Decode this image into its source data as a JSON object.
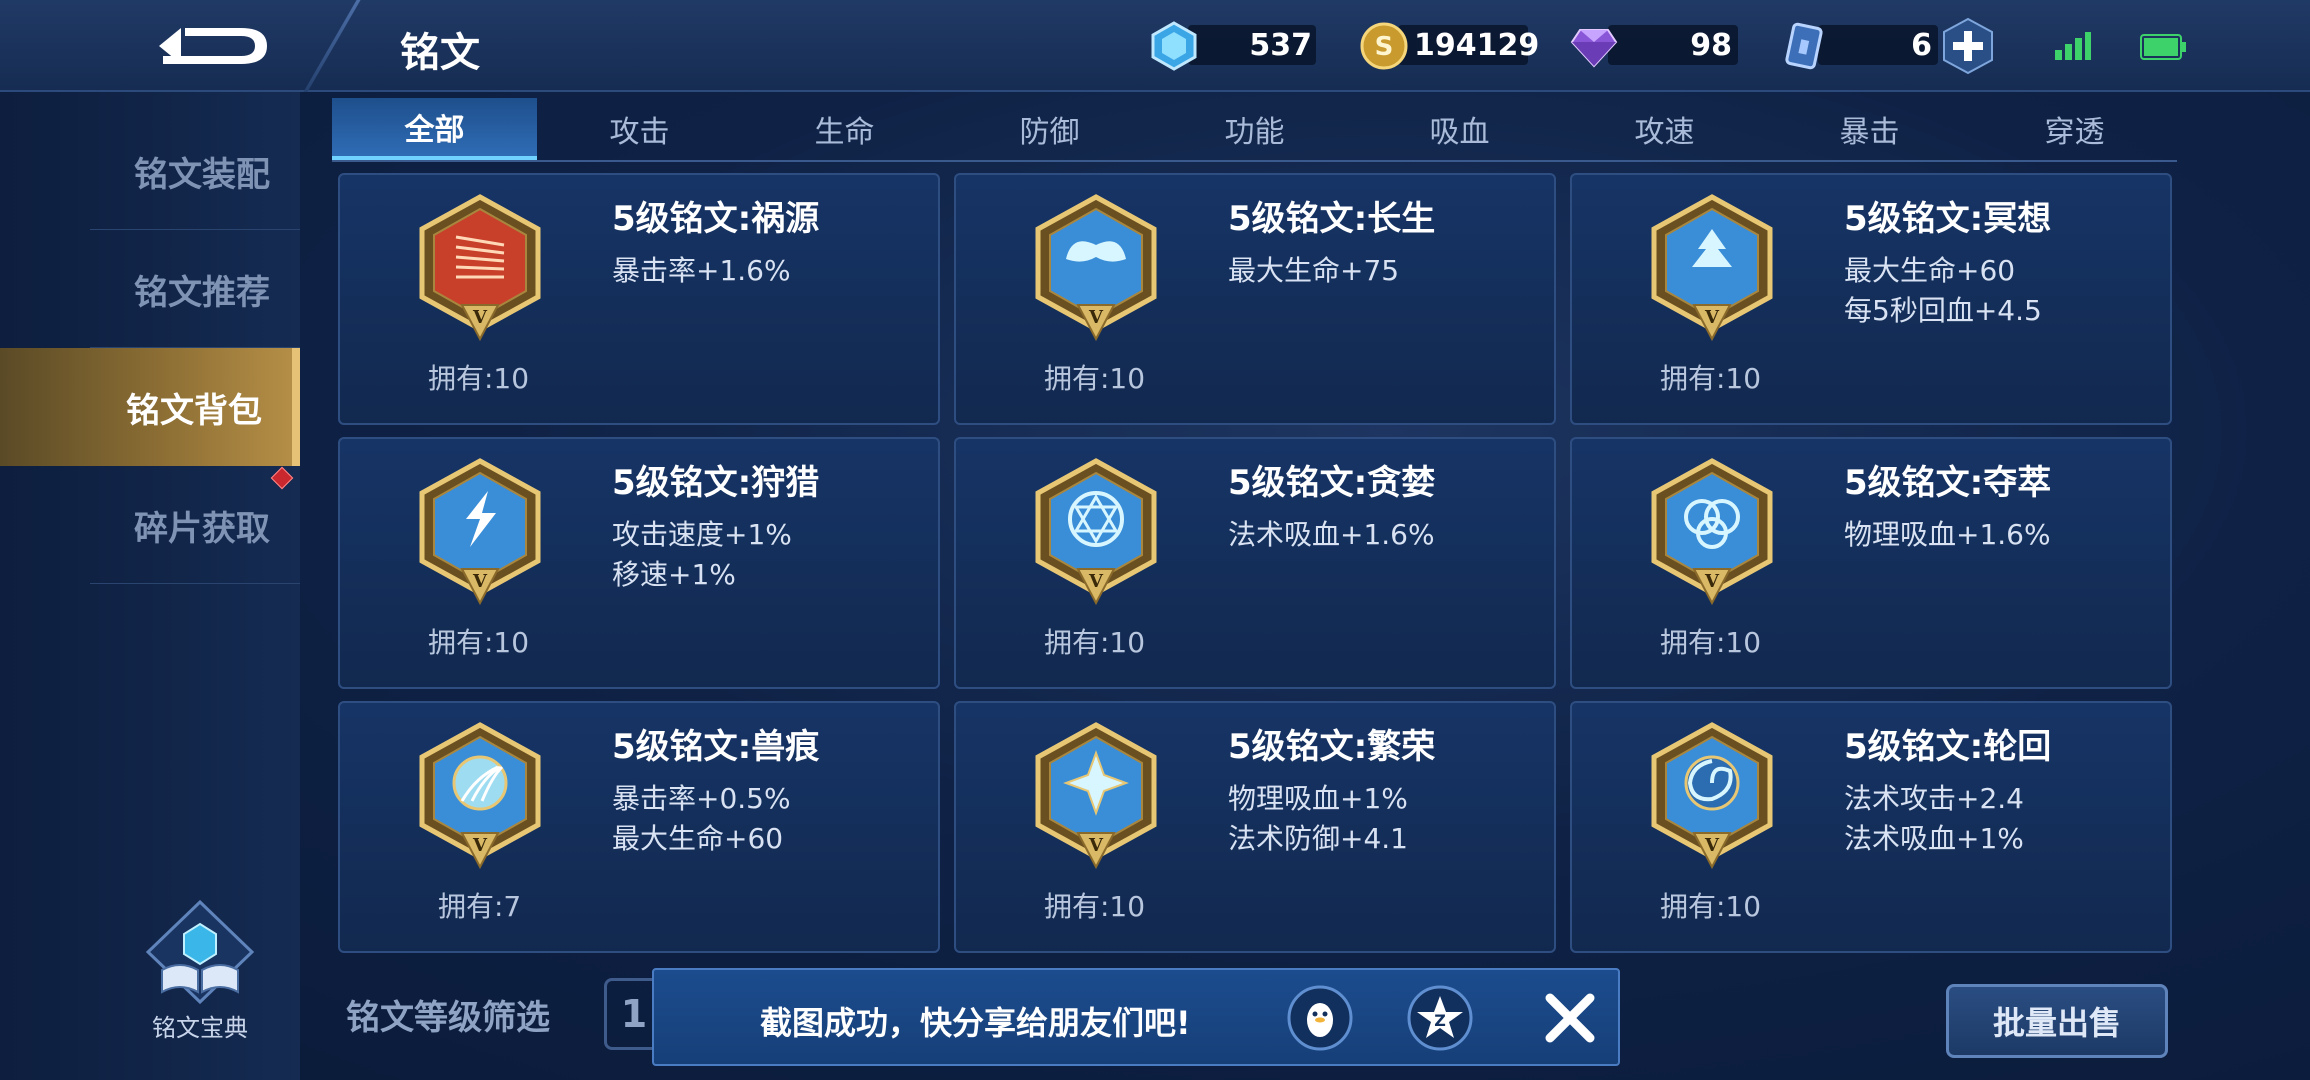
{
  "header": {
    "title": "铭文",
    "back_icon": "back-arrow-icon"
  },
  "currencies": {
    "crystal": {
      "value": "537",
      "icon": "blue-crystal-icon"
    },
    "gold": {
      "value": "194129",
      "icon": "gold-coin-icon"
    },
    "diamond": {
      "value": "98",
      "icon": "purple-diamond-icon"
    },
    "ticket": {
      "value": "6",
      "icon": "blue-card-icon"
    }
  },
  "tabs": [
    {
      "label": "全部",
      "active": true
    },
    {
      "label": "攻击"
    },
    {
      "label": "生命"
    },
    {
      "label": "防御"
    },
    {
      "label": "功能"
    },
    {
      "label": "吸血"
    },
    {
      "label": "攻速"
    },
    {
      "label": "暴击"
    },
    {
      "label": "穿透"
    }
  ],
  "sidebar": {
    "items": [
      {
        "label": "铭文装配"
      },
      {
        "label": "铭文推荐"
      },
      {
        "label": "铭文背包",
        "active": true
      },
      {
        "label": "碎片获取"
      }
    ],
    "codex_label": "铭文宝典"
  },
  "inscriptions": [
    {
      "name": "5级铭文:祸源",
      "stats": [
        "暴击率+1.6%"
      ],
      "owned": "拥有:10",
      "color": "#c8402a"
    },
    {
      "name": "5级铭文:长生",
      "stats": [
        "最大生命+75"
      ],
      "owned": "拥有:10",
      "color": "#3a8ed8"
    },
    {
      "name": "5级铭文:冥想",
      "stats": [
        "最大生命+60",
        "每5秒回血+4.5"
      ],
      "owned": "拥有:10",
      "color": "#3a8ed8"
    },
    {
      "name": "5级铭文:狩猎",
      "stats": [
        "攻击速度+1%",
        "移速+1%"
      ],
      "owned": "拥有:10",
      "color": "#3a8ed8"
    },
    {
      "name": "5级铭文:贪婪",
      "stats": [
        "法术吸血+1.6%"
      ],
      "owned": "拥有:10",
      "color": "#3a8ed8"
    },
    {
      "name": "5级铭文:夺萃",
      "stats": [
        "物理吸血+1.6%"
      ],
      "owned": "拥有:10",
      "color": "#3a8ed8"
    },
    {
      "name": "5级铭文:兽痕",
      "stats": [
        "暴击率+0.5%",
        "最大生命+60"
      ],
      "owned": "拥有:7",
      "color": "#3a8ed8"
    },
    {
      "name": "5级铭文:繁荣",
      "stats": [
        "物理吸血+1%",
        "法术防御+4.1"
      ],
      "owned": "拥有:10",
      "color": "#3a8ed8"
    },
    {
      "name": "5级铭文:轮回",
      "stats": [
        "法术攻击+2.4",
        "法术吸血+1%"
      ],
      "owned": "拥有:10",
      "color": "#3a8ed8"
    }
  ],
  "emblem_roman": "V",
  "footer": {
    "filter_label": "铭文等级筛选",
    "level_value": "1",
    "sell_label": "批量出售"
  },
  "toast": {
    "text": "截图成功，快分享给朋友们吧!",
    "share_icons": [
      "qq-penguin-icon",
      "qzone-star-icon"
    ],
    "close_icon": "close-icon"
  }
}
